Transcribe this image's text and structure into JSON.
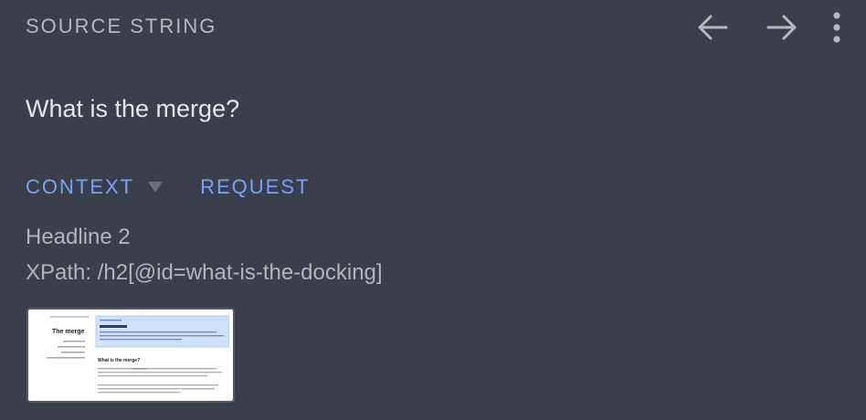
{
  "header": {
    "label": "SOURCE STRING",
    "prev_icon": "arrow-left-icon",
    "next_icon": "arrow-right-icon",
    "more_icon": "more-vertical-icon"
  },
  "source": {
    "text": "What is the merge?"
  },
  "tabs": {
    "context": "CONTEXT",
    "request": "REQUEST",
    "caret_icon": "caret-down-icon"
  },
  "context": {
    "type": "Headline 2",
    "xpath": "XPath: /h2[@id=what-is-the-docking]"
  },
  "screenshot": {
    "page_title": "The merge",
    "section_heading": "What is the merge?"
  },
  "colors": {
    "background": "#3a3f4b",
    "accent": "#79a2f2",
    "text_primary": "#e4e5e8",
    "text_secondary": "#b3b5ba"
  }
}
